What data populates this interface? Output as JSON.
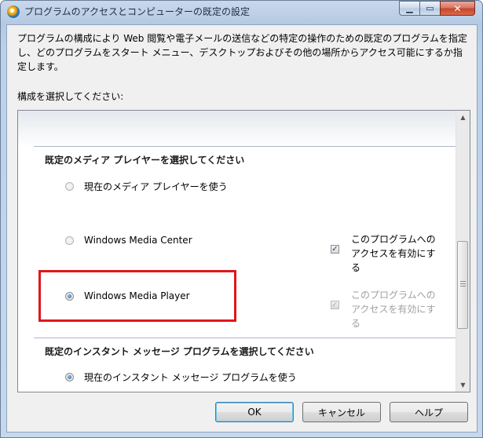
{
  "window": {
    "title": "プログラムのアクセスとコンピューターの既定の設定",
    "minimize_glyph": "▁",
    "maximize_glyph": "▭",
    "close_glyph": "✕"
  },
  "description": "プログラムの構成により Web 閲覧や電子メールの送信などの特定の操作のための既定のプログラムを指定し、どのプログラムをスタート メニュー、デスクトップおよびその他の場所からアクセス可能にするか指定します。",
  "choose_label": "構成を選択してください:",
  "media_section": {
    "heading": "既定のメディア プレイヤーを選択してください",
    "options": [
      {
        "label": "現在のメディア プレイヤーを使う",
        "selected": false
      },
      {
        "label": "Windows Media Center",
        "selected": false,
        "enable_label": "このプログラムへのアクセスを有効にする",
        "enable_checked": true,
        "enable_disabled": false
      },
      {
        "label": "Windows Media Player",
        "selected": true,
        "enable_label": "このプログラムへのアクセスを有効にする",
        "enable_checked": true,
        "enable_disabled": true
      }
    ]
  },
  "im_section": {
    "heading": "既定のインスタント メッセージ プログラムを選択してください",
    "options": [
      {
        "label": "現在のインスタント メッセージ プログラムを使う",
        "selected": true
      }
    ]
  },
  "scrollbar": {
    "up_glyph": "▲",
    "down_glyph": "▼"
  },
  "buttons": {
    "ok": "OK",
    "cancel": "キャンセル",
    "help": "ヘルプ"
  },
  "colors": {
    "highlight_border": "#e0161b",
    "title_bar": "#b9cde5",
    "dialog_bg": "#f0f0f0"
  },
  "icons": {
    "app": "default-programs-icon",
    "checkmark": "✓"
  }
}
